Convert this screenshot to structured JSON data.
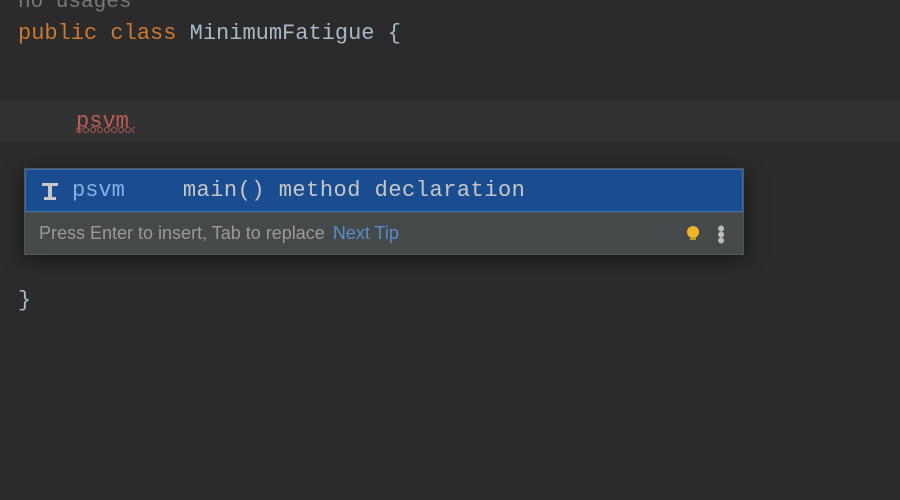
{
  "editor": {
    "usage_hint": "no usages",
    "kw_public": "public",
    "kw_class": "class",
    "class_name": "MinimumFatigue",
    "open_brace": "{",
    "close_brace": "}",
    "typed": "psvm"
  },
  "completion": {
    "items": [
      {
        "key": "psvm",
        "description": "main() method declaration"
      }
    ],
    "hint_text": "Press Enter to insert, Tab to replace",
    "next_tip_label": "Next Tip"
  },
  "icons": {
    "live_template": "live-template-icon",
    "bulb": "bulb-icon",
    "more": "more-icon"
  },
  "colors": {
    "background": "#2b2b2b",
    "keyword": "#cc7832",
    "selection": "#1a4d8f",
    "error": "#bc5c56"
  }
}
